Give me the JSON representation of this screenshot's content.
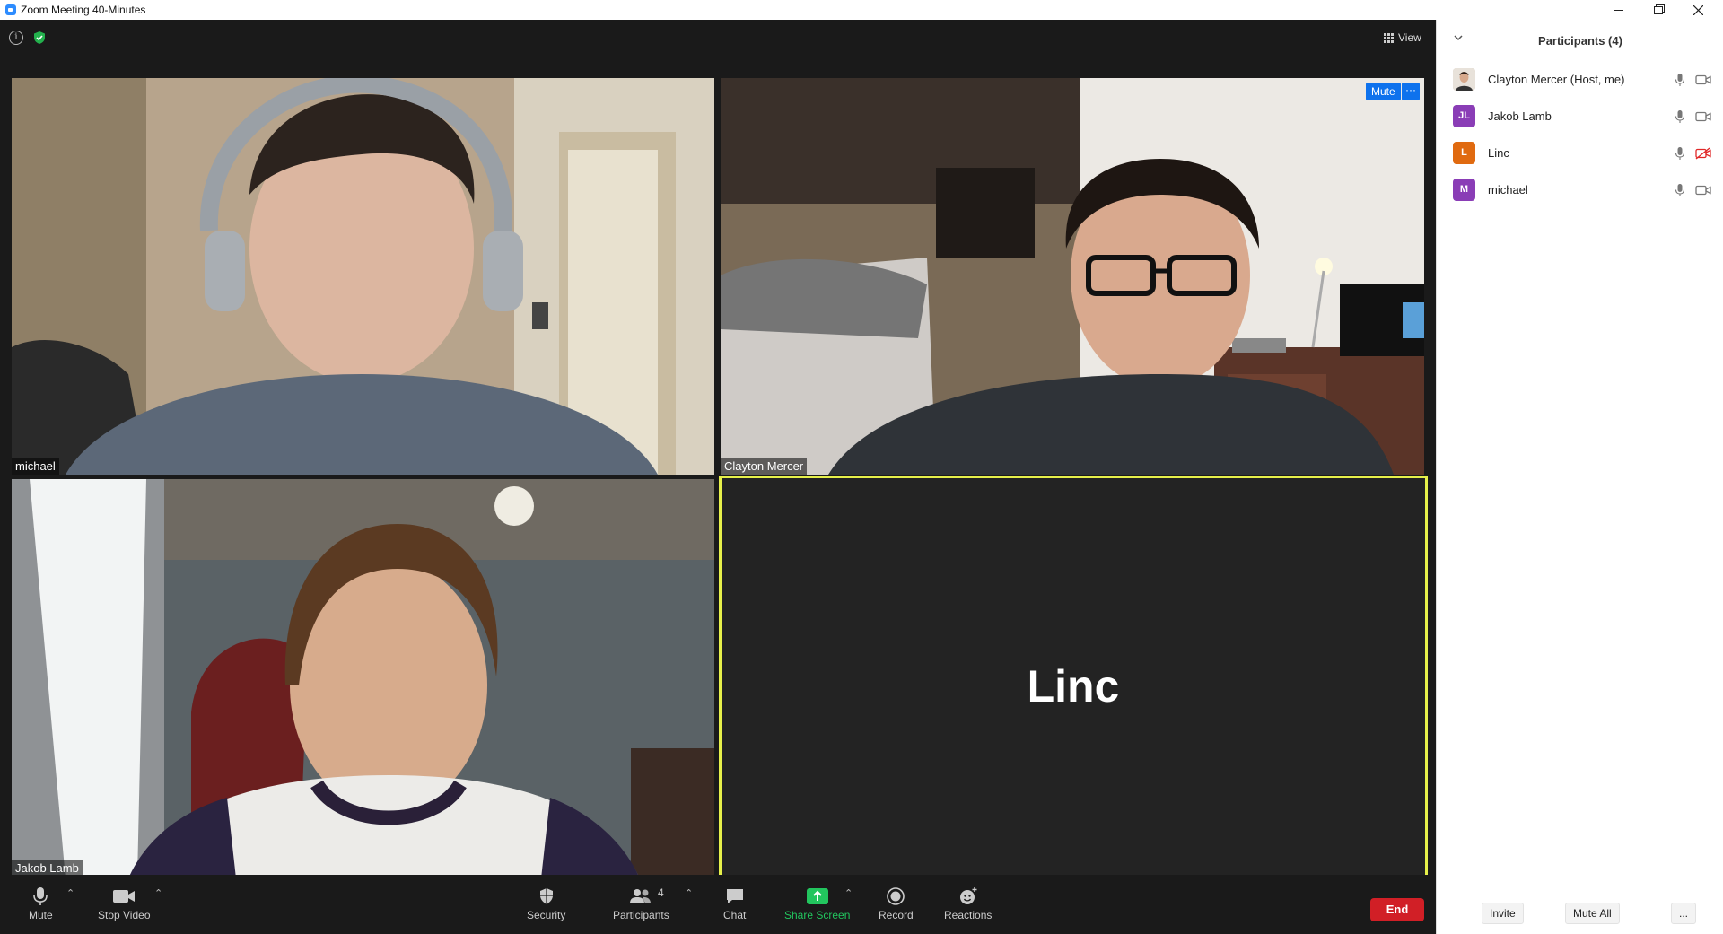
{
  "window": {
    "title": "Zoom Meeting 40-Minutes"
  },
  "meeting": {
    "view_label": "View",
    "tiles": [
      {
        "name": "michael"
      },
      {
        "name": "Clayton Mercer",
        "mute_label": "Mute",
        "more_label": "···"
      },
      {
        "name": "Jakob Lamb"
      },
      {
        "name": "Linc",
        "active_speaker": true
      }
    ]
  },
  "toolbar": {
    "mute_label": "Mute",
    "stop_video_label": "Stop Video",
    "security_label": "Security",
    "participants_label": "Participants",
    "participants_count": "4",
    "chat_label": "Chat",
    "share_screen_label": "Share Screen",
    "record_label": "Record",
    "reactions_label": "Reactions",
    "end_label": "End"
  },
  "panel": {
    "title": "Participants (4)",
    "participants": [
      {
        "name": "Clayton Mercer (Host, me)",
        "initials": "",
        "avatar_color": "#c8b8a8",
        "mic": "on",
        "video": "on"
      },
      {
        "name": "Jakob Lamb",
        "initials": "JL",
        "avatar_color": "#8a3db6",
        "mic": "on",
        "video": "on"
      },
      {
        "name": "Linc",
        "initials": "L",
        "avatar_color": "#e06a10",
        "mic": "on",
        "video": "off"
      },
      {
        "name": "michael",
        "initials": "M",
        "avatar_color": "#8a3db6",
        "mic": "on",
        "video": "on"
      }
    ],
    "invite_label": "Invite",
    "mute_all_label": "Mute All",
    "more_label": "..."
  },
  "colors": {
    "accent_blue": "#0e72ed",
    "share_green": "#22c55e",
    "end_red": "#d11f26",
    "active_speaker_border": "#e6f04a",
    "video_off_red": "#e02828"
  }
}
